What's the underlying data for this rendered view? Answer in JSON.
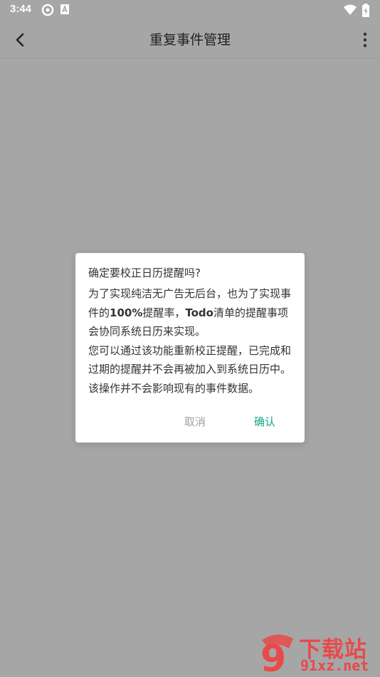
{
  "status_bar": {
    "time": "3:44",
    "icons": [
      "sync-icon",
      "app-a-icon",
      "wifi-icon",
      "battery-charging-icon"
    ]
  },
  "app_bar": {
    "title": "重复事件管理",
    "back_icon": "chevron-left-icon",
    "menu_icon": "more-vertical-icon"
  },
  "dialog": {
    "title": "确定要校正日历提醒吗?",
    "paragraph1_pre": "为了实现纯洁无广告无后台，也为了实现事件的",
    "paragraph1_bold1": "100%",
    "paragraph1_mid": "提醒率，",
    "paragraph1_bold2": "Todo",
    "paragraph1_post": "清单的提醒事项会协同系统日历来实现。",
    "paragraph2": "您可以通过该功能重新校正提醒，已完成和过期的提醒并不会再被加入到系统日历中。该操作并不会影响现有的事件数据。",
    "cancel_label": "取消",
    "confirm_label": "确认"
  },
  "watermark": {
    "logo_text": "9",
    "line1": "下载站",
    "line2": "91xz.net"
  },
  "colors": {
    "scrim": "#a6a6a6",
    "accent": "#1aa58a",
    "cancel": "#9e9e9e",
    "watermark": "#e84a4a"
  }
}
